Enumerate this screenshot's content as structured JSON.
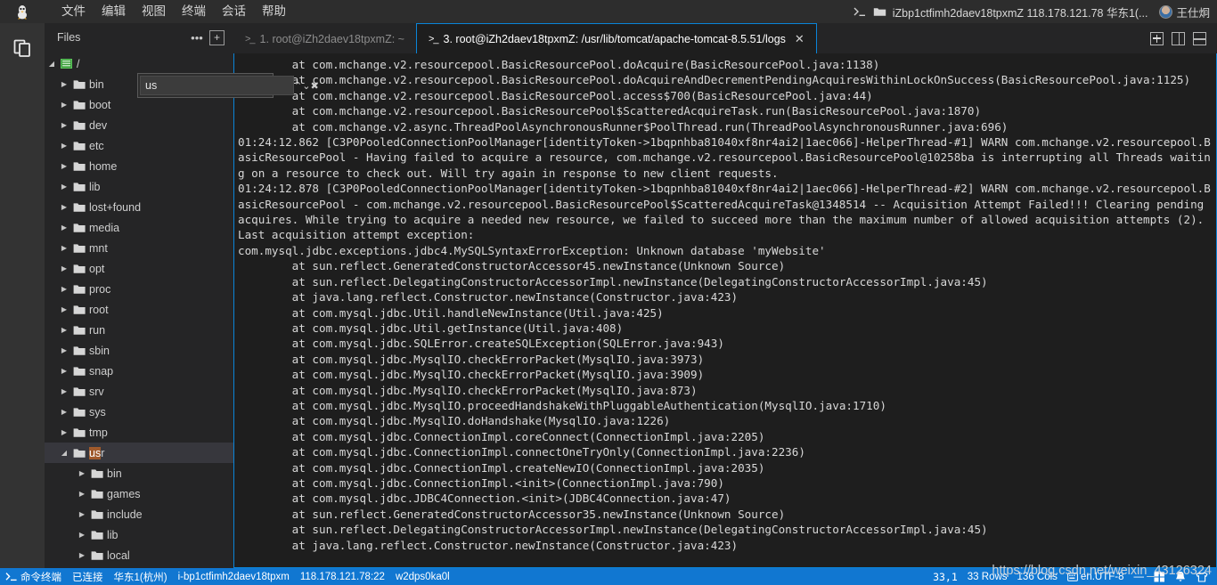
{
  "titlebar": {
    "app_icon": "tux-linux-logo",
    "menus": [
      "文件",
      "编辑",
      "视图",
      "终端",
      "会话",
      "帮助"
    ],
    "right_icons": [
      "terminal-prompt-icon",
      "folder-icon"
    ],
    "connection_path": "iZbp1ctfimh2daev18tpxmZ 118.178.121.78 华东1(...",
    "user_name": "王仕炯"
  },
  "activitybar": {
    "items": [
      {
        "name": "files-explorer-icon",
        "glyph": "documents"
      }
    ]
  },
  "sidebar": {
    "title": "Files",
    "more_label": "•••",
    "add_label": "+",
    "find": {
      "value": "us",
      "placeholder": "",
      "prev_label": "⌃",
      "next_label": "⌄",
      "close_label": "✖"
    },
    "root_label": "/",
    "tree": [
      {
        "label": "bin",
        "depth": 1,
        "expanded": false,
        "selected": false
      },
      {
        "label": "boot",
        "depth": 1,
        "expanded": false,
        "selected": false
      },
      {
        "label": "dev",
        "depth": 1,
        "expanded": false,
        "selected": false
      },
      {
        "label": "etc",
        "depth": 1,
        "expanded": false,
        "selected": false
      },
      {
        "label": "home",
        "depth": 1,
        "expanded": false,
        "selected": false
      },
      {
        "label": "lib",
        "depth": 1,
        "expanded": false,
        "selected": false
      },
      {
        "label": "lost+found",
        "depth": 1,
        "expanded": false,
        "selected": false
      },
      {
        "label": "media",
        "depth": 1,
        "expanded": false,
        "selected": false
      },
      {
        "label": "mnt",
        "depth": 1,
        "expanded": false,
        "selected": false
      },
      {
        "label": "opt",
        "depth": 1,
        "expanded": false,
        "selected": false
      },
      {
        "label": "proc",
        "depth": 1,
        "expanded": false,
        "selected": false
      },
      {
        "label": "root",
        "depth": 1,
        "expanded": false,
        "selected": false
      },
      {
        "label": "run",
        "depth": 1,
        "expanded": false,
        "selected": false
      },
      {
        "label": "sbin",
        "depth": 1,
        "expanded": false,
        "selected": false
      },
      {
        "label": "snap",
        "depth": 1,
        "expanded": false,
        "selected": false
      },
      {
        "label": "srv",
        "depth": 1,
        "expanded": false,
        "selected": false
      },
      {
        "label": "sys",
        "depth": 1,
        "expanded": false,
        "selected": false
      },
      {
        "label": "tmp",
        "depth": 1,
        "expanded": false,
        "selected": false
      },
      {
        "label": "usr",
        "depth": 1,
        "expanded": true,
        "selected": true,
        "highlight": "us"
      },
      {
        "label": "bin",
        "depth": 2,
        "expanded": false,
        "selected": false
      },
      {
        "label": "games",
        "depth": 2,
        "expanded": false,
        "selected": false
      },
      {
        "label": "include",
        "depth": 2,
        "expanded": false,
        "selected": false
      },
      {
        "label": "lib",
        "depth": 2,
        "expanded": false,
        "selected": false
      },
      {
        "label": "local",
        "depth": 2,
        "expanded": false,
        "selected": false
      }
    ]
  },
  "tabs": [
    {
      "label": "1. root@iZh2daev18tpxmZ: ~",
      "active": false,
      "closable": false
    },
    {
      "label": "3. root@iZh2daev18tpxmZ: /usr/lib/tomcat/apache-tomcat-8.5.51/logs",
      "active": true,
      "closable": true,
      "close_label": "✕"
    }
  ],
  "tabbar_actions": [
    {
      "name": "new-tab-button",
      "kind": "plus"
    },
    {
      "name": "split-vertical-button",
      "kind": "split-v"
    },
    {
      "name": "split-horizontal-button",
      "kind": "split-h"
    }
  ],
  "terminal": {
    "lines": [
      "        at com.mchange.v2.resourcepool.BasicResourcePool.doAcquire(BasicResourcePool.java:1138)",
      "        at com.mchange.v2.resourcepool.BasicResourcePool.doAcquireAndDecrementPendingAcquiresWithinLockOnSuccess(BasicResourcePool.java:1125)",
      "        at com.mchange.v2.resourcepool.BasicResourcePool.access$700(BasicResourcePool.java:44)",
      "        at com.mchange.v2.resourcepool.BasicResourcePool$ScatteredAcquireTask.run(BasicResourcePool.java:1870)",
      "        at com.mchange.v2.async.ThreadPoolAsynchronousRunner$PoolThread.run(ThreadPoolAsynchronousRunner.java:696)",
      "01:24:12.862 [C3P0PooledConnectionPoolManager[identityToken->1bqpnhba81040xf8nr4ai2|1aec066]-HelperThread-#1] WARN com.mchange.v2.resourcepool.BasicResourcePool - Having failed to acquire a resource, com.mchange.v2.resourcepool.BasicResourcePool@10258ba is interrupting all Threads waiting on a resource to check out. Will try again in response to new client requests.",
      "01:24:12.878 [C3P0PooledConnectionPoolManager[identityToken->1bqpnhba81040xf8nr4ai2|1aec066]-HelperThread-#2] WARN com.mchange.v2.resourcepool.BasicResourcePool - com.mchange.v2.resourcepool.BasicResourcePool$ScatteredAcquireTask@1348514 -- Acquisition Attempt Failed!!! Clearing pending acquires. While trying to acquire a needed new resource, we failed to succeed more than the maximum number of allowed acquisition attempts (2). Last acquisition attempt exception:",
      "com.mysql.jdbc.exceptions.jdbc4.MySQLSyntaxErrorException: Unknown database 'myWebsite'",
      "        at sun.reflect.GeneratedConstructorAccessor45.newInstance(Unknown Source)",
      "        at sun.reflect.DelegatingConstructorAccessorImpl.newInstance(DelegatingConstructorAccessorImpl.java:45)",
      "        at java.lang.reflect.Constructor.newInstance(Constructor.java:423)",
      "        at com.mysql.jdbc.Util.handleNewInstance(Util.java:425)",
      "        at com.mysql.jdbc.Util.getInstance(Util.java:408)",
      "        at com.mysql.jdbc.SQLError.createSQLException(SQLError.java:943)",
      "        at com.mysql.jdbc.MysqlIO.checkErrorPacket(MysqlIO.java:3973)",
      "        at com.mysql.jdbc.MysqlIO.checkErrorPacket(MysqlIO.java:3909)",
      "        at com.mysql.jdbc.MysqlIO.checkErrorPacket(MysqlIO.java:873)",
      "        at com.mysql.jdbc.MysqlIO.proceedHandshakeWithPluggableAuthentication(MysqlIO.java:1710)",
      "        at com.mysql.jdbc.MysqlIO.doHandshake(MysqlIO.java:1226)",
      "        at com.mysql.jdbc.ConnectionImpl.coreConnect(ConnectionImpl.java:2205)",
      "        at com.mysql.jdbc.ConnectionImpl.connectOneTryOnly(ConnectionImpl.java:2236)",
      "        at com.mysql.jdbc.ConnectionImpl.createNewIO(ConnectionImpl.java:2035)",
      "        at com.mysql.jdbc.ConnectionImpl.<init>(ConnectionImpl.java:790)",
      "        at com.mysql.jdbc.JDBC4Connection.<init>(JDBC4Connection.java:47)",
      "        at sun.reflect.GeneratedConstructorAccessor35.newInstance(Unknown Source)",
      "        at sun.reflect.DelegatingConstructorAccessorImpl.newInstance(DelegatingConstructorAccessorImpl.java:45)",
      "        at java.lang.reflect.Constructor.newInstance(Constructor.java:423)"
    ]
  },
  "statusbar": {
    "left": [
      {
        "name": "terminal-mode",
        "icon": "terminal-prompt-icon",
        "label": "命令终端"
      },
      {
        "name": "connection-state",
        "label": "已连接"
      },
      {
        "name": "region",
        "label": "华东1(杭州)"
      },
      {
        "name": "instance-id",
        "label": "i-bp1ctfimh2daev18tpxm"
      },
      {
        "name": "host-port",
        "label": "118.178.121.78:22"
      },
      {
        "name": "session-id",
        "label": "w2dps0ka0l"
      }
    ],
    "right": [
      {
        "name": "cursor-position",
        "label": "33,1"
      },
      {
        "name": "row-count",
        "label": "33 Rows"
      },
      {
        "name": "col-count",
        "label": "136 Cols"
      },
      {
        "name": "encoding",
        "icon": "keyboard-icon",
        "label": "en.UTF-8"
      },
      {
        "name": "minus-button",
        "label": "—"
      },
      {
        "name": "layout-grid-icon",
        "label": ""
      },
      {
        "name": "notifications-bell-icon",
        "label": ""
      },
      {
        "name": "shirt-icon",
        "label": ""
      }
    ]
  },
  "watermark": "https://blog.csdn.net/weixin_43126324",
  "colors": {
    "accent_blue": "#0a84d8",
    "statusbar_blue": "#1177d1",
    "titlebar_bg": "#2d2d2d",
    "sidebar_bg": "#252526",
    "terminal_bg": "#1e1e1e",
    "highlight_orange": "#a05a2c"
  }
}
